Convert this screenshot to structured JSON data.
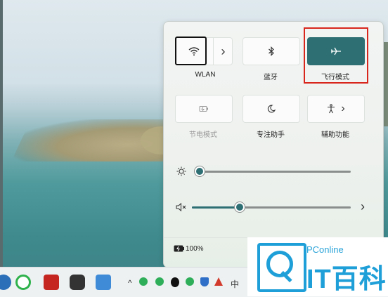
{
  "quick_settings": {
    "tiles": {
      "wlan": {
        "label": "WLAN",
        "icon": "wifi-icon",
        "chevron": "›"
      },
      "bluetooth": {
        "label": "蓝牙",
        "icon": "bluetooth-icon"
      },
      "airplane": {
        "label": "飞行模式",
        "icon": "airplane-icon",
        "active": true
      },
      "battery_saver": {
        "label": "节电模式",
        "icon": "battery-saver-icon",
        "disabled": true
      },
      "focus_assist": {
        "label": "专注助手",
        "icon": "moon-icon"
      },
      "accessibility": {
        "label": "辅助功能",
        "icon": "accessibility-icon",
        "chevron": "›"
      }
    },
    "brightness": {
      "icon": "brightness-icon",
      "level": 0.0
    },
    "volume": {
      "icon": "volume-muted-icon",
      "level": 0.29,
      "chevron": "›"
    },
    "battery": {
      "icon": "battery-icon",
      "percent": "100%"
    }
  },
  "taskbar": {
    "overflow": "^",
    "ime": "中"
  },
  "watermark": {
    "top_text": "PConline",
    "main_text": "IT百科"
  },
  "colors": {
    "accent": "#2e6f74",
    "highlight_box": "#d9261c",
    "watermark_blue": "#1f9fd8"
  }
}
